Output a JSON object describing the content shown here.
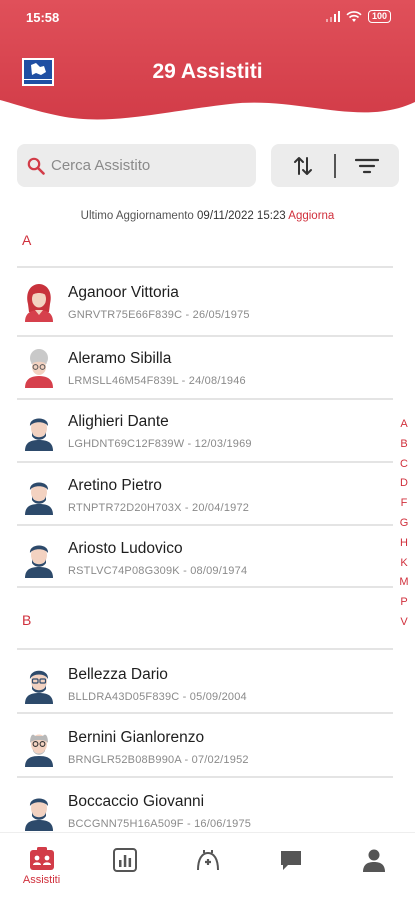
{
  "status_bar": {
    "time": "15:58",
    "battery": "100"
  },
  "header": {
    "title": "29 Assistiti"
  },
  "search": {
    "placeholder": "Cerca Assistito"
  },
  "last_update": {
    "label": "Ultimo Aggiornamento",
    "datetime": "09/11/2022 15:23",
    "refresh_link": "Aggiorna"
  },
  "sections": [
    {
      "letter": "A",
      "patients": [
        {
          "name": "Aganoor Vittoria",
          "code": "GNRVTR75E66F839C - 26/05/1975",
          "avatar": "woman-red-hair-avatar-icon"
        },
        {
          "name": "Aleramo Sibilla",
          "code": "LRMSLL46M54F839L - 24/08/1946",
          "avatar": "elderly-woman-avatar-icon"
        },
        {
          "name": "Alighieri Dante",
          "code": "LGHDNT69C12F839W - 12/03/1969",
          "avatar": "man-avatar-icon"
        },
        {
          "name": "Aretino Pietro",
          "code": "RTNPTR72D20H703X - 20/04/1972",
          "avatar": "man-avatar-icon"
        },
        {
          "name": "Ariosto Ludovico",
          "code": "RSTLVC74P08G309K - 08/09/1974",
          "avatar": "man-avatar-icon"
        }
      ]
    },
    {
      "letter": "B",
      "patients": [
        {
          "name": "Bellezza Dario",
          "code": "BLLDRA43D05F839C - 05/09/2004",
          "avatar": "man-glasses-avatar-icon"
        },
        {
          "name": "Bernini Gianlorenzo",
          "code": "BRNGLR52B08B990A - 07/02/1952",
          "avatar": "elderly-man-avatar-icon"
        },
        {
          "name": "Boccaccio Giovanni",
          "code": "BCCGNN75H16A509F - 16/06/1975",
          "avatar": "man-avatar-icon"
        }
      ]
    }
  ],
  "alpha_index": [
    "A",
    "B",
    "C",
    "D",
    "F",
    "G",
    "H",
    "K",
    "M",
    "P",
    "V"
  ],
  "bottom_nav": [
    {
      "label": "Assistiti",
      "icon": "patients-list-icon",
      "active": true
    },
    {
      "label": "",
      "icon": "stats-chart-icon",
      "active": false
    },
    {
      "label": "",
      "icon": "medical-bag-icon",
      "active": false
    },
    {
      "label": "",
      "icon": "chat-bubble-icon",
      "active": false
    },
    {
      "label": "",
      "icon": "user-profile-icon",
      "active": false
    }
  ],
  "colors": {
    "brand_red": "#d6404c",
    "accent_text": "#d0303c",
    "avatar_blue": "#2d4a6b"
  }
}
